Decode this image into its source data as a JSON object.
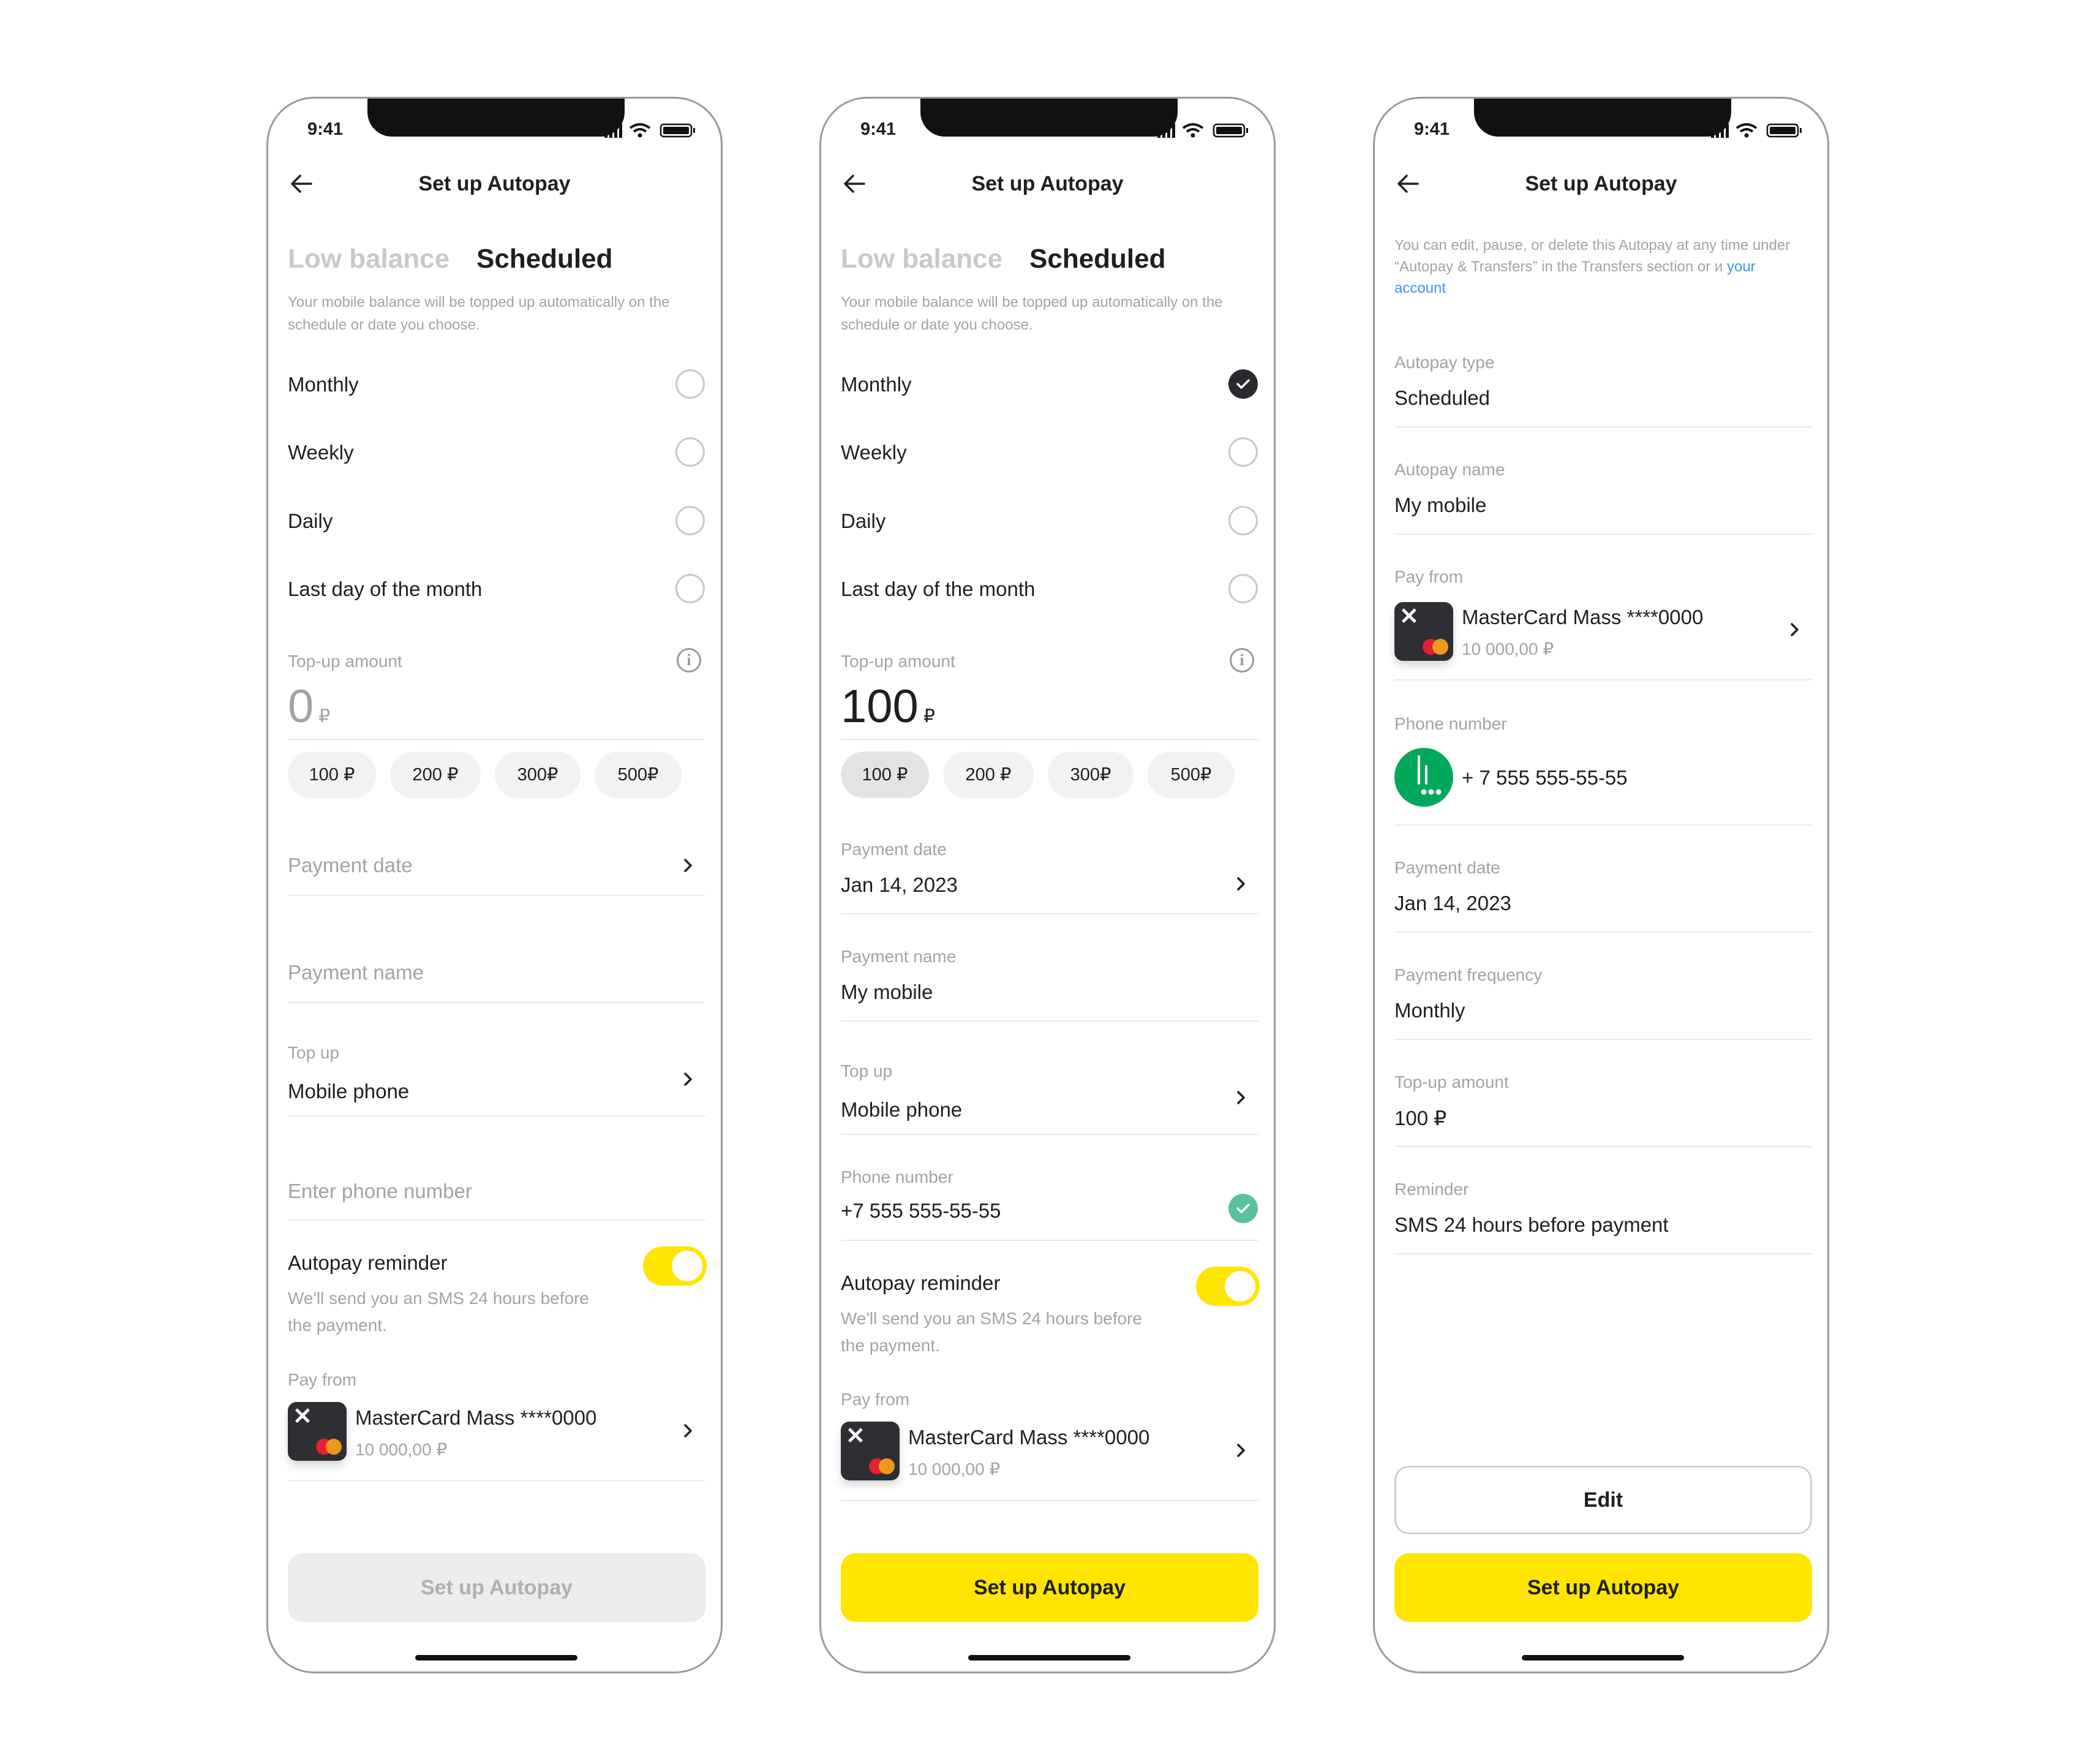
{
  "status_time": "9:41",
  "nav": {
    "title": "Set up Autopay"
  },
  "tabs": {
    "low_balance": "Low balance",
    "scheduled": "Scheduled"
  },
  "description": "Your mobile balance will be topped up automatically on the schedule or date you choose.",
  "options": [
    "Monthly",
    "Weekly",
    "Daily",
    "Last day of the month"
  ],
  "labels": {
    "topup_amount": "Top-up amount",
    "payment_date": "Payment date",
    "payment_name": "Payment name",
    "top_up": "Top up",
    "enter_phone": "Enter phone number",
    "phone_number": "Phone number",
    "autopay_reminder": "Autopay reminder",
    "reminder_desc": "We'll send you an SMS 24 hours before the payment.",
    "pay_from": "Pay from",
    "currency": "₽",
    "info_glyph": "i"
  },
  "chips": [
    "100 ₽",
    "200 ₽",
    "300₽",
    "500₽"
  ],
  "card": {
    "name": "MasterCard Mass ****0000",
    "balance": "10 000,00 ₽"
  },
  "screen1": {
    "amount": "0",
    "top_up_value": "Mobile phone",
    "button": "Set up Autopay"
  },
  "screen2": {
    "amount": "100",
    "selected_option": "Monthly",
    "selected_chip": "100 ₽",
    "payment_date": "Jan 14, 2023",
    "payment_name": "My mobile",
    "top_up_value": "Mobile phone",
    "phone": "+7 555 555-55-55",
    "button": "Set up Autopay"
  },
  "screen3": {
    "notice_text": "You can edit, pause, or delete this Autopay at any time under “Autopay & Transfers” in the Transfers section or и",
    "notice_link": "your account",
    "fields": [
      {
        "label": "Autopay type",
        "value": "Scheduled"
      },
      {
        "label": "Autopay name",
        "value": "My mobile"
      }
    ],
    "pay_from_label": "Pay from",
    "phone_label": "Phone number",
    "phone": "+ 7 555 555-55-55",
    "fields2": [
      {
        "label": "Payment date",
        "value": "Jan 14, 2023"
      },
      {
        "label": "Payment frequency",
        "value": "Monthly"
      },
      {
        "label": "Top-up amount",
        "value": "100 ₽"
      },
      {
        "label": "Reminder",
        "value": "SMS 24 hours before payment"
      }
    ],
    "edit_button": "Edit",
    "button": "Set up Autopay"
  },
  "colors": {
    "accent": "#ffe500",
    "link": "#3b96f2",
    "success": "#5cbf9f",
    "operator": "#00a859"
  }
}
